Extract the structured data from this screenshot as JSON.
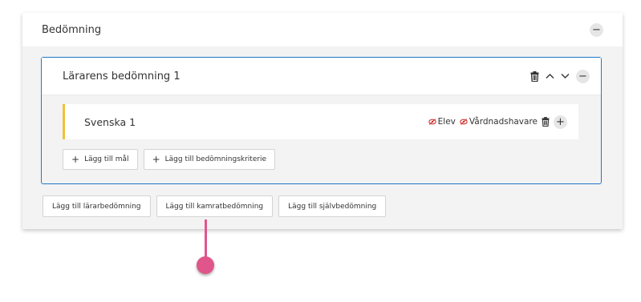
{
  "section": {
    "title": "Bedömning",
    "collapse_symbol": "−"
  },
  "assessment": {
    "title": "Lärarens bedömning 1",
    "collapse_symbol": "−",
    "subject": {
      "title": "Svenska 1",
      "visibility": [
        {
          "label": "Elev"
        },
        {
          "label": "Vårdnadshavare"
        }
      ],
      "add_symbol": "+"
    },
    "buttons": {
      "add_goal": "Lägg till mål",
      "add_criteria": "Lägg till bedömningskriterie",
      "plus_symbol": "+"
    }
  },
  "panel_buttons": {
    "teacher": "Lägg till lärarbedömning",
    "peer": "Lägg till kamratbedömning",
    "self": "Lägg till självbedömning"
  },
  "colors": {
    "accent_blue": "#1f78c8",
    "subject_bar": "#f2c037",
    "pointer": "#e0558a",
    "hidden_icon": "#d0312d"
  }
}
